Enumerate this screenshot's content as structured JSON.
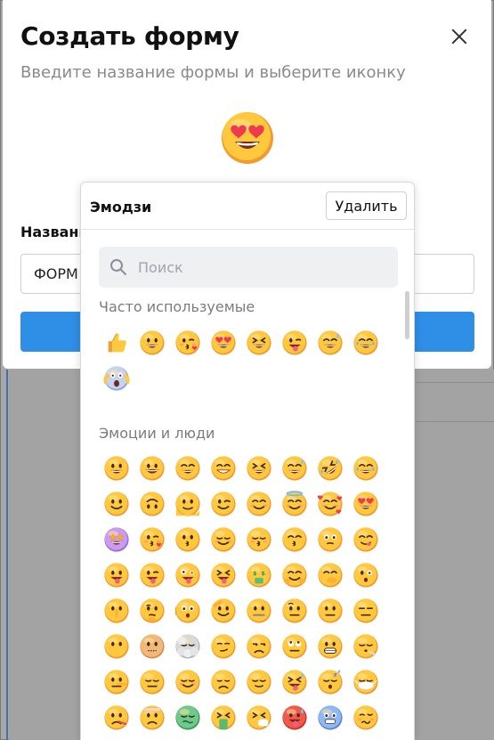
{
  "modal": {
    "title": "Создать форму",
    "subtitle": "Введите название формы и выберите иконку",
    "name_label": "Названи",
    "name_value": "ФОРМ",
    "selected_icon": "heart-eyes"
  },
  "picker": {
    "title": "Эмодзи",
    "delete_label": "Удалить",
    "search_placeholder": "Поиск",
    "sections": [
      {
        "title": "Часто используемые",
        "items": [
          "thumbs-up",
          "grin",
          "kiss-heart",
          "heart-eyes",
          "squint-laugh",
          "wink-tongue",
          "sweat-smile",
          "tears-joy",
          "scream"
        ]
      },
      {
        "title": "Эмоции и люди",
        "items": [
          "grin",
          "grin-big",
          "smile-eyes",
          "beam",
          "squint-laugh",
          "sweat-smile",
          "rofl",
          "tears-joy",
          "slight-smile",
          "upside-down",
          "melting",
          "wink",
          "blush",
          "halo",
          "hearts-face",
          "heart-eyes",
          "star-struck",
          "kiss-heart",
          "kissing",
          "relaxed",
          "kiss-closed",
          "kiss-smile",
          "holding-tears",
          "yum",
          "tongue",
          "wink-tongue",
          "zany",
          "squint-tongue",
          "money-mouth",
          "hug",
          "hand-mouth",
          "peek",
          "shush",
          "thinking",
          "shaking",
          "salute",
          "zipper",
          "raised-brow",
          "neutral",
          "expressionless",
          "no-mouth",
          "dotted-face",
          "clouds-face",
          "smirk",
          "unamused",
          "eye-roll",
          "grimace",
          "exhale",
          "lying",
          "sleepy",
          "relieved",
          "pensive",
          "drool",
          "tongue-sweat",
          "sleeping",
          "mask",
          "thermometer",
          "bandage",
          "nauseated",
          "vomit",
          "sneeze",
          "hot-face",
          "cold-face",
          "woozy"
        ]
      }
    ]
  },
  "colors": {
    "primary": "#2f8ee5",
    "face": "#ffc83d",
    "face_dark": "#f29a2e"
  }
}
